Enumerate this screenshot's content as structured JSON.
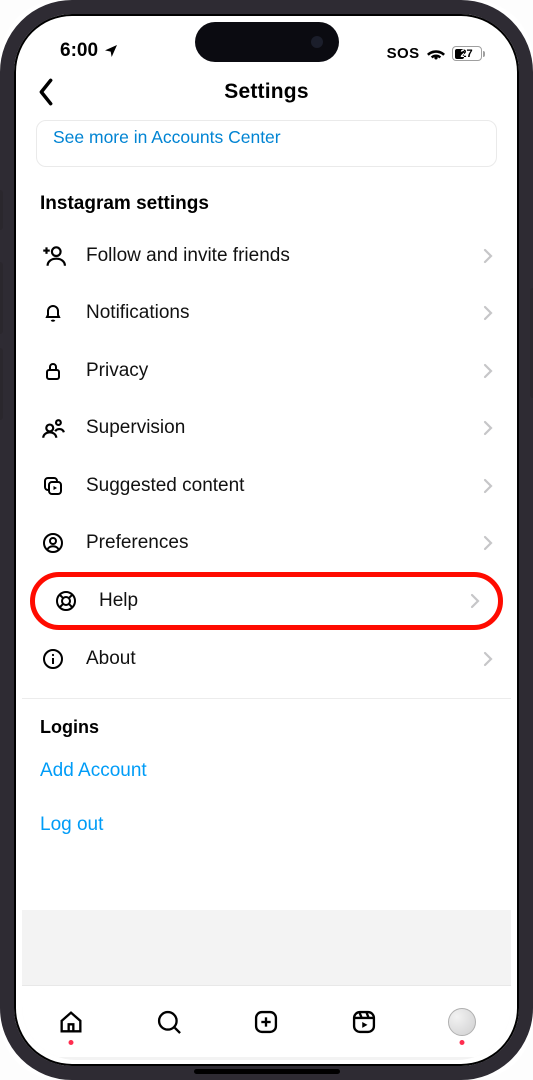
{
  "status": {
    "time": "6:00",
    "sos": "SOS",
    "battery": "27"
  },
  "nav": {
    "title": "Settings"
  },
  "accounts_center": {
    "link": "See more in Accounts Center"
  },
  "settings_section": {
    "title": "Instagram settings",
    "rows": {
      "follow": "Follow and invite friends",
      "notifications": "Notifications",
      "privacy": "Privacy",
      "supervision": "Supervision",
      "suggested": "Suggested content",
      "preferences": "Preferences",
      "help": "Help",
      "about": "About"
    }
  },
  "logins": {
    "title": "Logins",
    "add": "Add Account",
    "logout": "Log out"
  }
}
